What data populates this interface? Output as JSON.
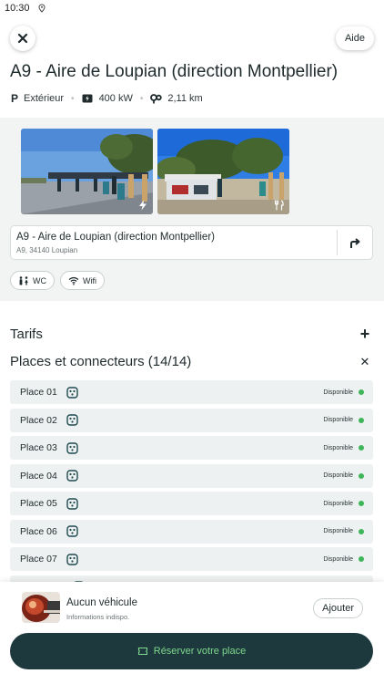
{
  "status_bar": {
    "time": "10:30",
    "icon": "location-pin-icon"
  },
  "header": {
    "close_icon": "close-icon",
    "help_label": "Aide"
  },
  "station": {
    "title": "A9 - Aire de Loupian (direction Montpellier)",
    "parking_label": "Extérieur",
    "power_label": "400 kW",
    "distance_label": "2,11 km"
  },
  "photos": [
    {
      "icon": "charging-bolt-icon"
    },
    {
      "icon": "restaurant-icon"
    }
  ],
  "address_card": {
    "name": "A9 - Aire de Loupian (direction Montpellier)",
    "address": "A9, 34140 Loupian",
    "icon": "directions-icon"
  },
  "amenities": [
    {
      "label": "WC",
      "icon": "restroom-icon"
    },
    {
      "label": "Wifi",
      "icon": "wifi-icon"
    }
  ],
  "sections": {
    "tarifs": {
      "label": "Tarifs",
      "toggle": "+"
    },
    "places": {
      "label": "Places et connecteurs (14/14)",
      "toggle": "✕"
    }
  },
  "places": [
    {
      "label": "Place 01",
      "status": "Disponible"
    },
    {
      "label": "Place 02",
      "status": "Disponible"
    },
    {
      "label": "Place 03",
      "status": "Disponible"
    },
    {
      "label": "Place 04",
      "status": "Disponible"
    },
    {
      "label": "Place 05",
      "status": "Disponible"
    },
    {
      "label": "Place 06",
      "status": "Disponible"
    },
    {
      "label": "Place 07",
      "status": "Disponible"
    },
    {
      "label": "",
      "status": ""
    }
  ],
  "vehicle": {
    "name": "Aucun véhicule",
    "subtitle": "Informations indispo.",
    "add_label": "Ajouter"
  },
  "reserve": {
    "label": "Réserver votre place",
    "icon": "ticket-icon"
  },
  "colors": {
    "primary_dark": "#1d393e",
    "accent_green": "#7fd88c",
    "available_dot": "#3fb55a",
    "panel_gray": "#f2f4f4"
  }
}
